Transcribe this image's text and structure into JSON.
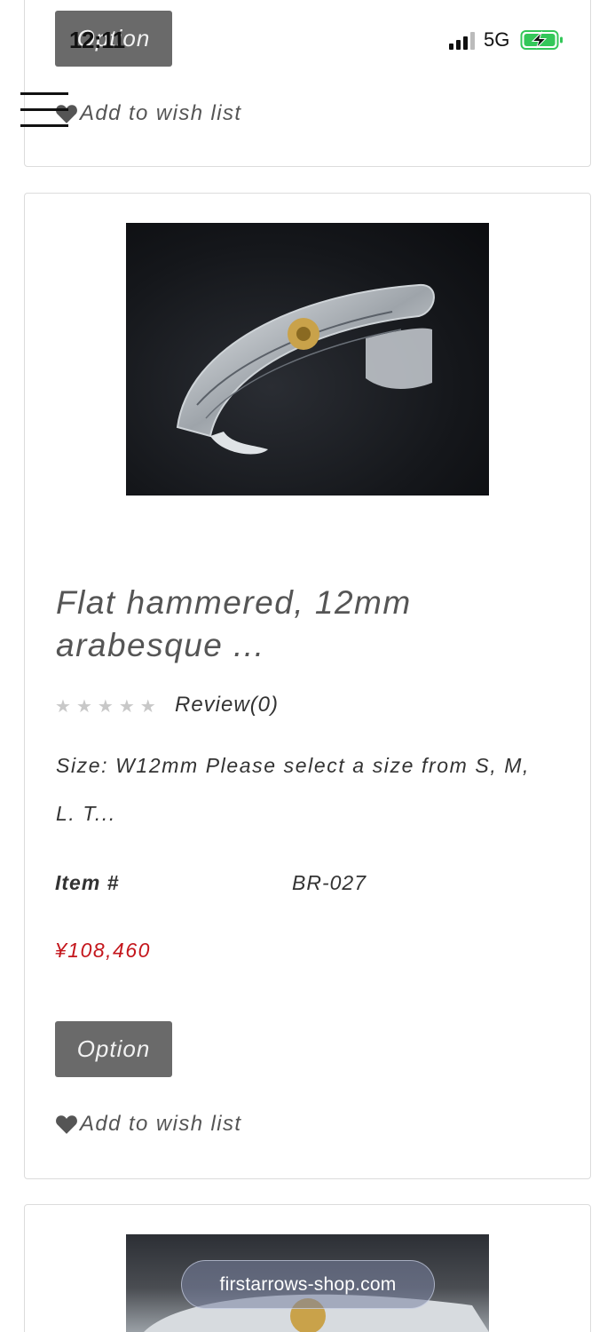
{
  "status_bar": {
    "time": "12:11",
    "network": "5G",
    "signal_bars": 3,
    "battery_color": "#34c759"
  },
  "product_prev": {
    "option_label": "Option",
    "wishlist_label": "Add to wish list"
  },
  "product": {
    "title": "Flat hammered, 12mm arabesque ...",
    "rating_stars": 0,
    "review_label": "Review(0)",
    "description": "Size: W12mm Please select a size from S, M, L. T...",
    "item_label": "Item #",
    "item_value": "BR-027",
    "price": "¥108,460",
    "price_color": "#c4161c",
    "option_label": "Option",
    "wishlist_label": "Add to wish list"
  },
  "browser": {
    "url": "firstarrows-shop.com"
  }
}
